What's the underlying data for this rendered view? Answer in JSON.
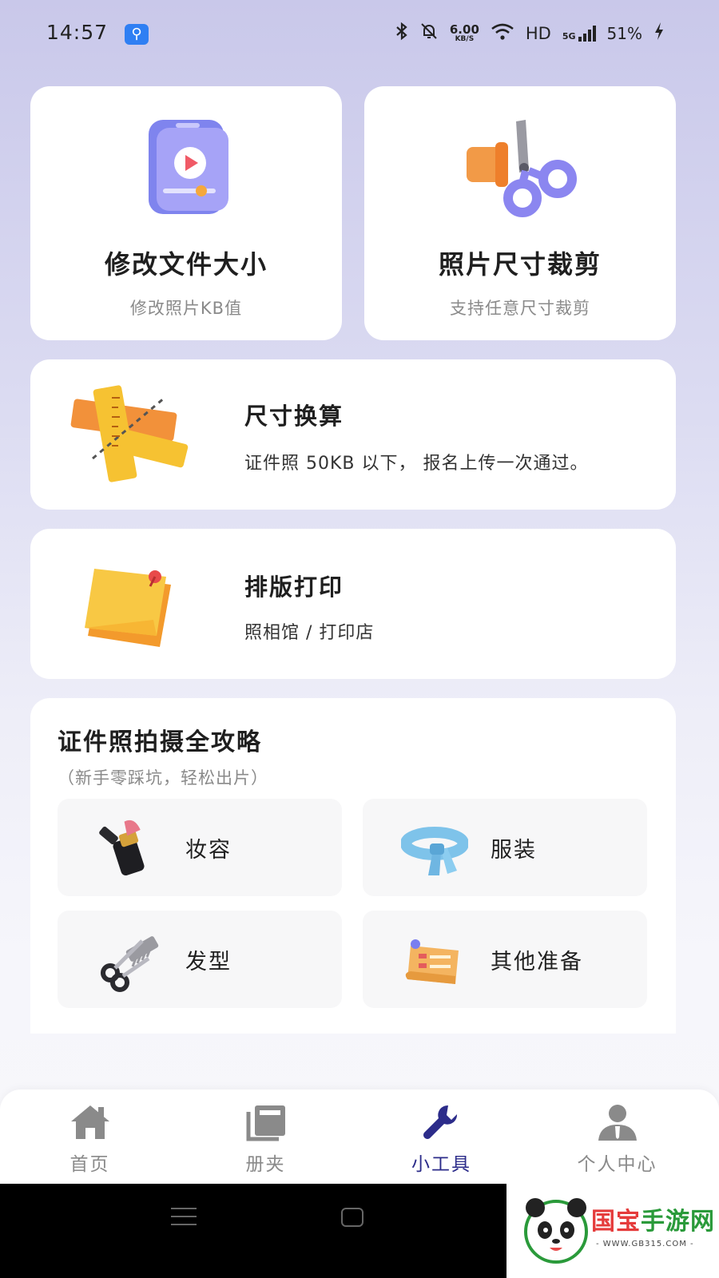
{
  "status": {
    "time": "14:57",
    "net_speed_value": "6.00",
    "net_speed_unit": "KB/S",
    "hd": "HD",
    "network": "5G",
    "battery": "51%"
  },
  "tools": {
    "compress": {
      "title": "修改文件大小",
      "subtitle": "修改照片KB值",
      "icon": "phone-video-icon"
    },
    "crop": {
      "title": "照片尺寸裁剪",
      "subtitle": "支持任意尺寸裁剪",
      "icon": "scissors-icon"
    },
    "convert": {
      "title": "尺寸换算",
      "desc": "证件照 50KB 以下， 报名上传一次通过。",
      "icon": "rulers-icon"
    },
    "print": {
      "title": "排版打印",
      "desc": "照相馆 / 打印店",
      "icon": "sticky-note-icon"
    }
  },
  "guide": {
    "title": "证件照拍摄全攻略",
    "subtitle": "（新手零踩坑，轻松出片）",
    "items": [
      {
        "label": "妆容",
        "icon": "lipstick-icon"
      },
      {
        "label": "服装",
        "icon": "scarf-icon"
      },
      {
        "label": "发型",
        "icon": "scissors-comb-icon"
      },
      {
        "label": "其他准备",
        "icon": "scroll-icon"
      }
    ]
  },
  "nav": {
    "items": [
      {
        "label": "首页",
        "icon": "home-icon"
      },
      {
        "label": "册夹",
        "icon": "album-icon"
      },
      {
        "label": "小工具",
        "icon": "wrench-icon",
        "active": true
      },
      {
        "label": "个人中心",
        "icon": "person-icon"
      }
    ]
  },
  "watermark": {
    "brand_red": "国宝",
    "brand_green": "手游网",
    "url": "- WWW.GB315.COM -"
  },
  "colors": {
    "active_nav": "#2c2c8a",
    "accent_purple": "#8b86f0",
    "accent_orange": "#f2913a"
  }
}
